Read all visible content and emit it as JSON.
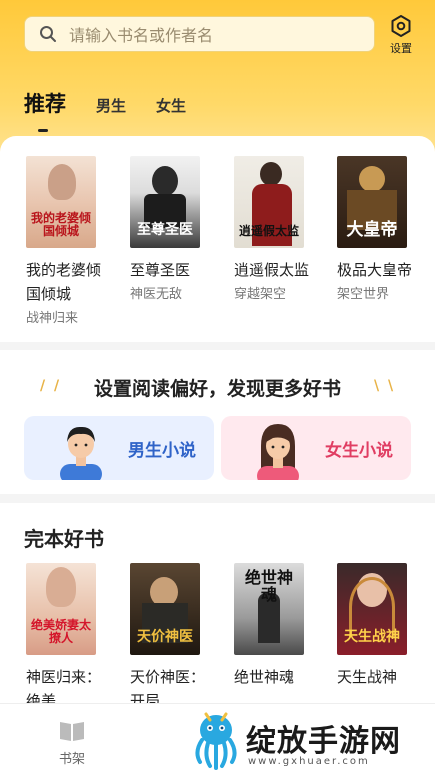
{
  "search": {
    "placeholder": "请输入书名或作者名"
  },
  "settings": {
    "label": "设置"
  },
  "tabs": [
    {
      "label": "推荐",
      "active": true
    },
    {
      "label": "男生"
    },
    {
      "label": "女生"
    }
  ],
  "featured_books": [
    {
      "name": "我的老婆倾国倾城",
      "category": "战神归来",
      "cover_text": "我的老婆倾国倾城"
    },
    {
      "name": "至尊圣医",
      "category": "神医无敌",
      "cover_text": "至尊圣医"
    },
    {
      "name": "逍遥假太监",
      "category": "穿越架空",
      "cover_text": "逍遥假太监"
    },
    {
      "name": "极品大皇帝",
      "category": "架空世界",
      "cover_text": "大皇帝"
    }
  ],
  "preference": {
    "title": "设置阅读偏好，发现更多好书",
    "male_label": "男生小说",
    "female_label": "女生小说"
  },
  "finished_section": {
    "title": "完本好书",
    "books": [
      {
        "name": "神医归来：绝美",
        "cover_text": "绝美娇妻太撩人"
      },
      {
        "name": "天价神医：开局",
        "cover_text": "天价神医"
      },
      {
        "name": "绝世神魂",
        "cover_text": "绝世神魂"
      },
      {
        "name": "天生战神",
        "cover_text": "天生战神"
      }
    ]
  },
  "bottom_nav": {
    "shelf_label": "书架"
  },
  "watermark": {
    "text": "绽放手游网",
    "url": "www.gxhuaer.com"
  }
}
